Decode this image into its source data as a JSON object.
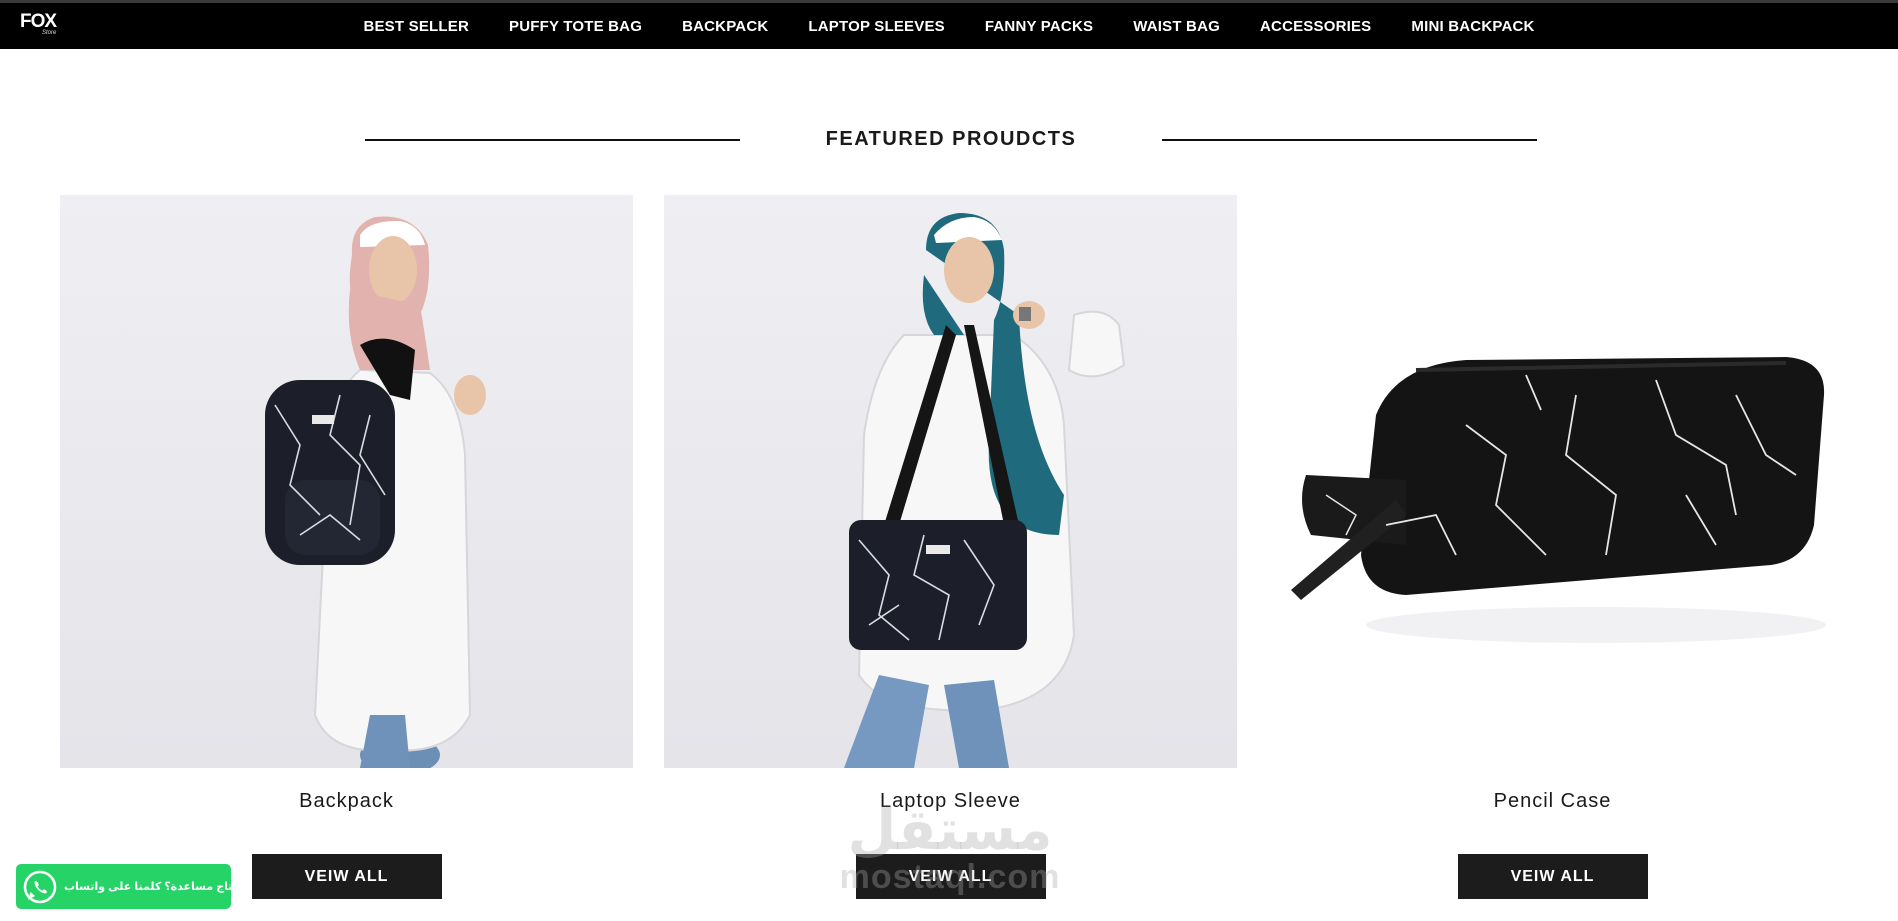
{
  "header": {
    "logo_text": "FOX",
    "logo_sub": "Store",
    "nav_items": [
      "BEST SELLER",
      "PUFFY TOTE BAG",
      "BACKPACK",
      "LAPTOP SLEEVES",
      "FANNY PACKS",
      "WAIST BAG",
      "ACCESSORIES",
      "MINI BACKPACK"
    ]
  },
  "section": {
    "title": "FEATURED PROUDCTS"
  },
  "products": [
    {
      "name": "Backpack",
      "button_label": "VEIW ALL",
      "image": "model-wearing-black-marble-backpack"
    },
    {
      "name": "Laptop Sleeve",
      "button_label": "VEIW ALL",
      "image": "model-carrying-black-marble-laptop-sleeve"
    },
    {
      "name": "Pencil Case",
      "button_label": "VEIW ALL",
      "image": "black-marble-pencil-case"
    }
  ],
  "whatsapp": {
    "label": "محتاج مساعدة؟ كلمنا على واتساب",
    "icon": "whatsapp-icon"
  },
  "watermark": {
    "arabic": "مستقل",
    "latin": "mostaql.com"
  },
  "colors": {
    "nav_bg": "#000000",
    "button_bg": "#1c1c1c",
    "whatsapp": "#25d366"
  }
}
